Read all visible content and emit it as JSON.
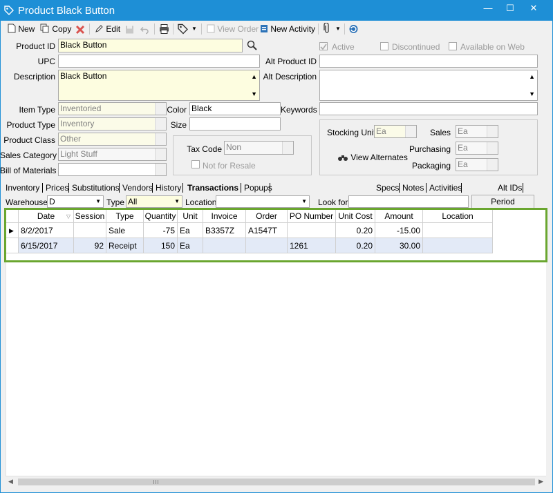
{
  "window": {
    "title": "Product Black Button",
    "min": "—",
    "max": "☐",
    "close": "✕"
  },
  "toolbar": {
    "new": "New",
    "copy": "Copy",
    "edit": "Edit",
    "view_order": "View Order",
    "new_activity": "New Activity"
  },
  "form": {
    "product_id_label": "Product ID",
    "product_id": "Black Button",
    "upc_label": "UPC",
    "upc": "",
    "description_label": "Description",
    "description": "Black Button",
    "active_label": "Active",
    "discontinued_label": "Discontinued",
    "available_on_web_label": "Available on Web",
    "alt_product_id_label": "Alt Product ID",
    "alt_product_id": "",
    "alt_description_label": "Alt Description",
    "alt_description": "",
    "item_type_label": "Item Type",
    "item_type": "Inventoried",
    "product_type_label": "Product Type",
    "product_type": "Inventory",
    "product_class_label": "Product Class",
    "product_class": "Other",
    "sales_category_label": "Sales Category",
    "sales_category": "Light Stuff",
    "bill_of_materials_label": "Bill of Materials",
    "bill_of_materials": "",
    "color_label": "Color",
    "color": "Black",
    "size_label": "Size",
    "size": "",
    "keywords_label": "Keywords",
    "keywords": "",
    "tax_code_label": "Tax Code",
    "tax_code": "Non",
    "not_for_resale_label": "Not for Resale",
    "stocking_unit_label": "Stocking Unit",
    "stocking_unit": "Ea",
    "sales_label": "Sales",
    "sales_unit": "Ea",
    "purchasing_label": "Purchasing",
    "purchasing_unit": "Ea",
    "packaging_label": "Packaging",
    "packaging_unit": "Ea",
    "view_alternates": "View Alternates"
  },
  "tabs_left": [
    "Inventory",
    "Prices",
    "Substitutions",
    "Vendors",
    "History",
    "Transactions",
    "Popups"
  ],
  "tabs_right": [
    "Specs",
    "Notes",
    "Activities",
    "Alt IDs"
  ],
  "filters": {
    "warehouse_label": "Warehouse",
    "warehouse": "D",
    "type_label": "Type",
    "type": "All",
    "location_label": "Location",
    "location": "",
    "look_for_label": "Look for",
    "look_for": "",
    "period_summary": "Period Summary"
  },
  "grid": {
    "columns": [
      "Date",
      "Session",
      "Type",
      "Quantity",
      "Unit",
      "Invoice",
      "Order",
      "PO Number",
      "Unit Cost",
      "Amount",
      "Location"
    ],
    "rows": [
      [
        "8/2/2017",
        "",
        "Sale",
        "-75",
        "Ea",
        "B3357Z",
        "A1547T",
        "",
        "0.20",
        "-15.00",
        ""
      ],
      [
        "6/15/2017",
        "92",
        "Receipt",
        "150",
        "Ea",
        "",
        "",
        "1261",
        "0.20",
        "30.00",
        ""
      ]
    ]
  },
  "colors": {
    "titlebar": "#1e8fd6",
    "highlight": "#6aa62f",
    "required_field": "#fdfde0"
  }
}
